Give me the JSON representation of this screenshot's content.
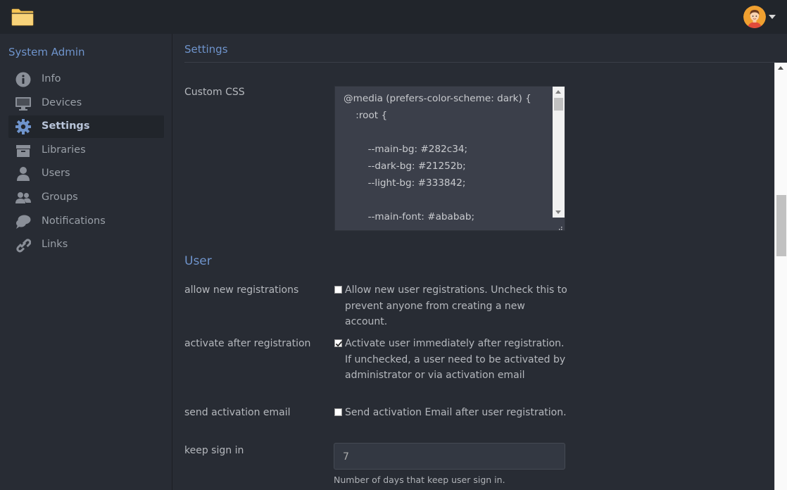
{
  "app": {
    "logo_icon": "folder-icon",
    "avatar_icon": "user-avatar-icon"
  },
  "sidebar": {
    "title": "System Admin",
    "items": [
      {
        "label": "Info",
        "icon": "info-icon",
        "active": false
      },
      {
        "label": "Devices",
        "icon": "monitor-icon",
        "active": false
      },
      {
        "label": "Settings",
        "icon": "gear-icon",
        "active": true
      },
      {
        "label": "Libraries",
        "icon": "archive-icon",
        "active": false
      },
      {
        "label": "Users",
        "icon": "user-icon",
        "active": false
      },
      {
        "label": "Groups",
        "icon": "users-icon",
        "active": false
      },
      {
        "label": "Notifications",
        "icon": "comments-icon",
        "active": false
      },
      {
        "label": "Links",
        "icon": "link-icon",
        "active": false
      }
    ]
  },
  "page": {
    "title": "Settings",
    "custom_css": {
      "label": "Custom CSS",
      "lines": [
        "@media (prefers-color-scheme: dark) {",
        "    :root {",
        "",
        "        --main-bg: #282c34;",
        "        --dark-bg: #21252b;",
        "        --light-bg: #333842;",
        "",
        "        --main-font: #ababab;"
      ]
    },
    "user_section": {
      "title": "User",
      "allow_registrations": {
        "label": "allow new registrations",
        "checked": false,
        "description": "Allow new user registrations. Uncheck this to prevent anyone from creating a new account."
      },
      "activate_after_registration": {
        "label": "activate after registration",
        "checked": true,
        "description": "Activate user immediately after registration. If unchecked, a user need to be activated by administrator or via activation email"
      },
      "send_activation_email": {
        "label": "send activation email",
        "checked": false,
        "description": "Send activation Email after user registration."
      },
      "keep_sign_in": {
        "label": "keep sign in",
        "value": "7",
        "help": "Number of days that keep user sign in."
      }
    }
  },
  "colors": {
    "accent": "#6f94cc",
    "background": "#282c34",
    "topbar": "#21252b",
    "input_bg": "#333842",
    "text": "#ababab"
  }
}
